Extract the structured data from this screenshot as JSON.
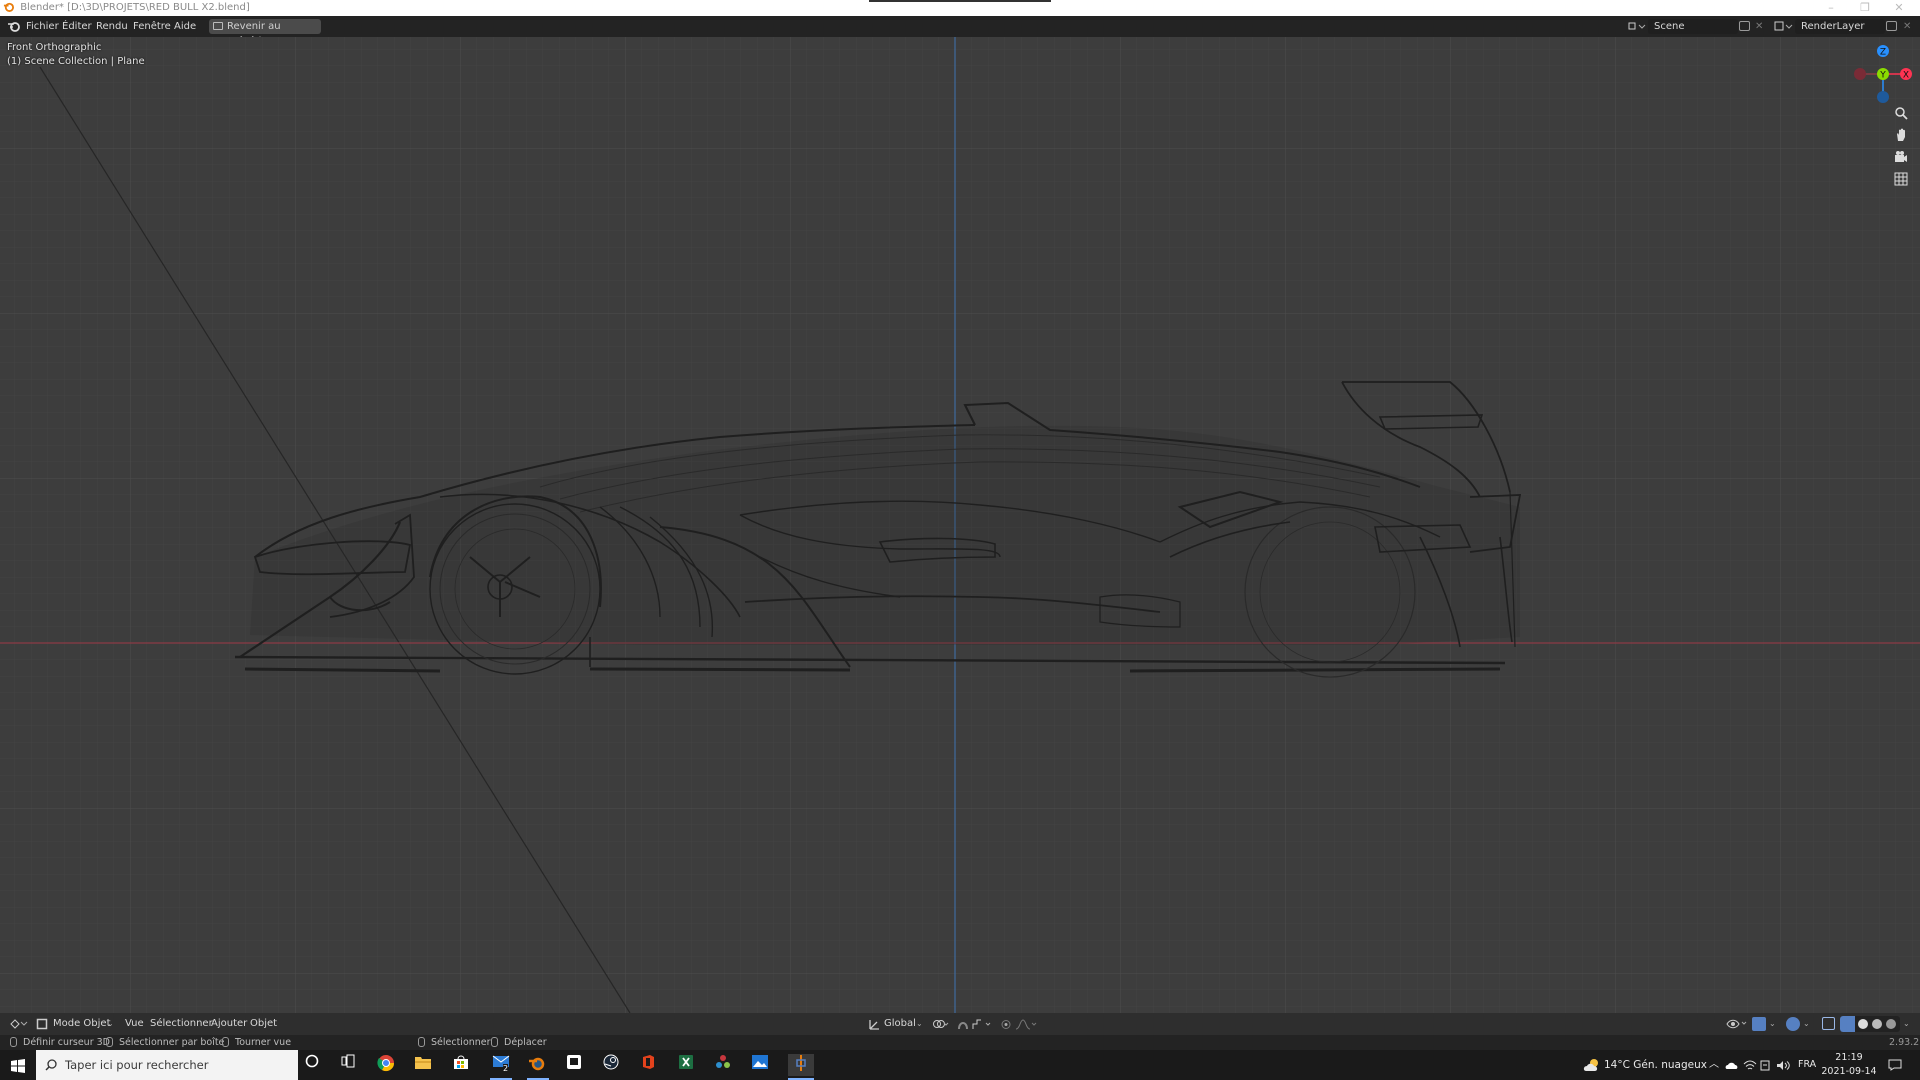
{
  "window": {
    "title": "Blender* [D:\\3D\\PROJETS\\RED BULL X2.blend]",
    "controls": {
      "minimize": "–",
      "maximize": "❐",
      "close": "✕"
    }
  },
  "topbar": {
    "menus": [
      "Fichier",
      "Éditer",
      "Rendu",
      "Fenêtre",
      "Aide"
    ],
    "back_button": "Revenir au précédent",
    "scene": "Scene",
    "render_layer": "RenderLayer"
  },
  "viewport": {
    "view_name": "Front Orthographic",
    "collection": "(1) Scene Collection | Plane",
    "gizmo": {
      "z": "Z",
      "y": "Y",
      "x": "X"
    },
    "nav_icons": [
      "zoom-icon",
      "hand-pan-icon",
      "camera-icon",
      "grid-icon"
    ]
  },
  "header3d": {
    "mode": "Mode Objet",
    "menus": [
      "Vue",
      "Sélectionner",
      "Ajouter",
      "Objet"
    ],
    "transform": "Global"
  },
  "statusbar": {
    "items": [
      "Définir curseur 3D",
      "Sélectionner par boîte",
      "Tourner vue",
      "Sélectionner",
      "Déplacer"
    ],
    "version": "2.93.2"
  },
  "taskbar": {
    "search_placeholder": "Taper ici pour rechercher",
    "weather": "14°C  Gén. nuageux",
    "language": "FRA",
    "time": "21:19",
    "date": "2021-09-14",
    "mail_badge": "2",
    "apps": [
      "cortana-icon",
      "task-view-icon",
      "chrome-icon",
      "file-explorer-icon",
      "store-icon",
      "mail-icon",
      "blender-icon",
      "epic-icon",
      "steam-icon",
      "office-icon",
      "excel-icon",
      "davinci-icon",
      "photos-icon",
      "blender-active-icon"
    ]
  },
  "colors": {
    "accent": "#5680c2",
    "x_axis": "#ff3352",
    "y_axis": "#8bdc00",
    "z_axis": "#2890ff",
    "viewport_bg": "#3d3d3d"
  }
}
